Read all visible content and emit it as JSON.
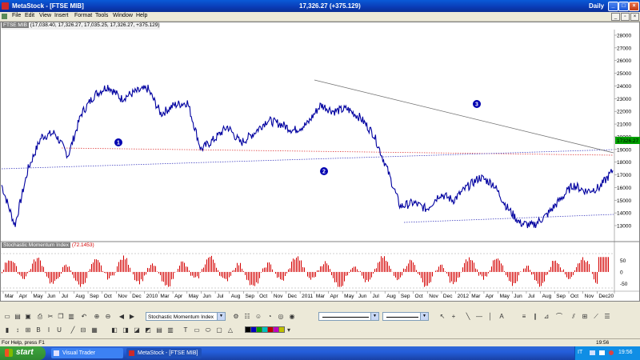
{
  "window": {
    "app_name": "MetaStock - [FTSE MIB]",
    "quote": "17,326.27 (+375.129)",
    "period": "Daily"
  },
  "menu": [
    "File",
    "Edit",
    "View",
    "Insert",
    "Format",
    "Tools",
    "Window",
    "Help"
  ],
  "chart": {
    "symbol": "FTSE MIB",
    "ohlc_text": "(17,038.40, 17,326.27, 17,035.25, 17,326.27, +375.129)",
    "price_axis": [
      "28000",
      "27000",
      "26000",
      "25000",
      "24000",
      "23000",
      "22000",
      "21000",
      "20000",
      "19000",
      "18000",
      "17000",
      "16000",
      "15000",
      "14000",
      "13000"
    ],
    "last_price_label": "17326.27",
    "markers": [
      "1",
      "2",
      "3"
    ],
    "indicator_name": "Stochastic Momentum Index",
    "indicator_value": "(72.1453)",
    "indicator_axis": [
      "50",
      "0",
      "-50"
    ],
    "time_axis": [
      "Mar",
      "Apr",
      "May",
      "Jun",
      "Jul",
      "Aug",
      "Sep",
      "Oct",
      "Nov",
      "Dec",
      "2010",
      "Mar",
      "Apr",
      "May",
      "Jun",
      "Jul",
      "Aug",
      "Sep",
      "Oct",
      "Nov",
      "Dec",
      "2011",
      "Mar",
      "Apr",
      "May",
      "Jun",
      "Jul",
      "Aug",
      "Sep",
      "Oct",
      "Nov",
      "Dec",
      "2012",
      "Mar",
      "Apr",
      "May",
      "Jun",
      "Jul",
      "Aug",
      "Sep",
      "Oct",
      "Nov",
      "Dec20"
    ]
  },
  "chart_data": {
    "type": "line",
    "title": "FTSE MIB",
    "x": [
      "2009-02",
      "2009-03",
      "2009-04",
      "2009-05",
      "2009-06",
      "2009-07",
      "2009-08",
      "2009-09",
      "2009-10",
      "2009-11",
      "2009-12",
      "2010-01",
      "2010-02",
      "2010-03",
      "2010-04",
      "2010-05",
      "2010-06",
      "2010-07",
      "2010-08",
      "2010-09",
      "2010-10",
      "2010-11",
      "2010-12",
      "2011-01",
      "2011-02",
      "2011-03",
      "2011-04",
      "2011-05",
      "2011-06",
      "2011-07",
      "2011-08",
      "2011-09",
      "2011-10",
      "2011-11",
      "2011-12",
      "2012-01",
      "2012-02",
      "2012-03",
      "2012-04",
      "2012-05",
      "2012-06",
      "2012-07",
      "2012-08",
      "2012-09",
      "2012-10",
      "2012-11",
      "2012-12"
    ],
    "series": [
      {
        "values": [
          16200,
          13000,
          17500,
          20000,
          20300,
          18500,
          21800,
          23300,
          24000,
          23000,
          23500,
          23800,
          21800,
          22500,
          22700,
          19000,
          19800,
          20800,
          19500,
          20300,
          21300,
          21000,
          20500,
          21000,
          22500,
          22000,
          22200,
          21500,
          20200,
          17500,
          14500,
          14800,
          14300,
          15500,
          15000,
          16000,
          16800,
          16300,
          14500,
          13200,
          13000,
          13800,
          15000,
          16200,
          15700,
          16000,
          17326
        ]
      }
    ],
    "ylim": [
      12500,
      28000
    ],
    "indicator": {
      "name": "Stochastic Momentum Index",
      "last": 72.1453,
      "ylim": [
        -70,
        80
      ]
    }
  },
  "toolbar": {
    "indicator_select": "Stochastic Momentum Index",
    "line_style_1": "",
    "line_style_2": ""
  },
  "colors": {
    "price": "#0000a0",
    "oscillator": "#d40000",
    "trend": "#808080",
    "support_red": "#e04040",
    "support_blue": "#4040c0",
    "marker": "#0000b0"
  },
  "status": {
    "help": "For Help, press F1",
    "time": "19:56"
  },
  "taskbar": {
    "start": "start",
    "tasks": [
      "Visual Trader",
      "MetaStock - [FTSE MIB]"
    ],
    "lang": "IT",
    "clock": "19:56"
  }
}
